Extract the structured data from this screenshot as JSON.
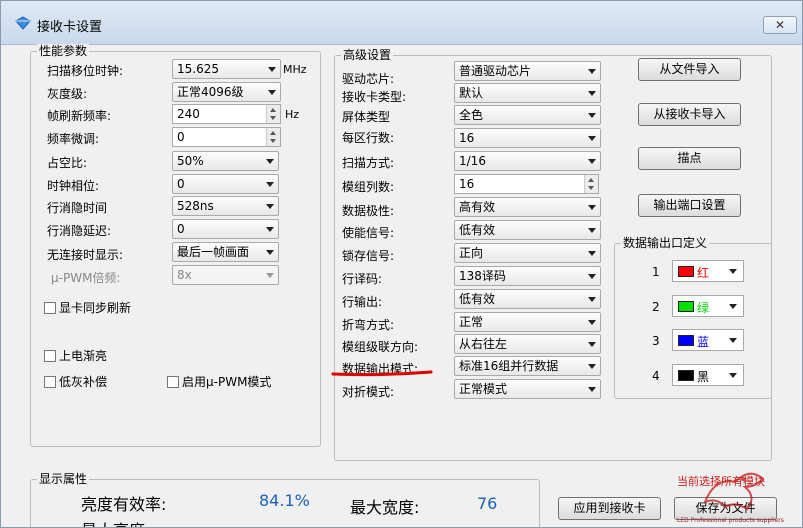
{
  "window": {
    "title": "接收卡设置",
    "close_label": "✕"
  },
  "perf": {
    "legend": "性能参数",
    "scan_clock": {
      "label": "扫描移位时钟:",
      "value": "15.625",
      "unit": "MHz"
    },
    "gray": {
      "label": "灰度级:",
      "value": "正常4096级"
    },
    "refresh": {
      "label": "帧刷新频率:",
      "value": "240",
      "unit": "Hz"
    },
    "freq_fine": {
      "label": "频率微调:",
      "value": "0"
    },
    "duty": {
      "label": "占空比:",
      "value": "50%"
    },
    "clock_phase": {
      "label": "时钟相位:",
      "value": "0"
    },
    "blank_time": {
      "label": "行消隐时间",
      "value": "528ns"
    },
    "blank_delay": {
      "label": "行消隐延迟:",
      "value": "0"
    },
    "no_link": {
      "label": "无连接时显示:",
      "value": "最后一帧画面"
    },
    "upwm_mult": {
      "label": "μ-PWM倍频:",
      "value": "8x"
    },
    "chk_vsync": "显卡同步刷新",
    "chk_poweron": "上电渐亮",
    "chk_lowgray": "低灰补偿",
    "chk_upwm": "启用μ-PWM模式"
  },
  "adv": {
    "legend": "高级设置",
    "driver_chip": {
      "label": "驱动芯片:",
      "value": "普通驱动芯片"
    },
    "card_type": {
      "label": "接收卡类型:",
      "value": "默认"
    },
    "screen_type": {
      "label": "屏体类型",
      "value": "全色"
    },
    "rows_per_zone": {
      "label": "每区行数:",
      "value": "16"
    },
    "scan_mode": {
      "label": "扫描方式:",
      "value": "1/16"
    },
    "module_cols": {
      "label": "模组列数:",
      "value": "16"
    },
    "data_polarity": {
      "label": "数据极性:",
      "value": "高有效"
    },
    "enable_signal": {
      "label": "使能信号:",
      "value": "低有效"
    },
    "latch_signal": {
      "label": "锁存信号:",
      "value": "正向"
    },
    "row_decode": {
      "label": "行译码:",
      "value": "138译码"
    },
    "row_output": {
      "label": "行输出:",
      "value": "低有效"
    },
    "fold_mode": {
      "label": "折弯方式:",
      "value": "正常"
    },
    "cascade_dir": {
      "label": "模组级联方向:",
      "value": "从右往左"
    },
    "data_output_mode": {
      "label": "数据输出模式:",
      "value": "标准16组并行数据"
    },
    "fold_pair_mode": {
      "label": "对折模式:",
      "value": "正常模式"
    }
  },
  "buttons": {
    "import_file": "从文件导入",
    "import_card": "从接收卡导入",
    "trace_point": "描点",
    "output_port": "输出端口设置",
    "apply": "应用到接收卡",
    "save_file": "保存为文件"
  },
  "output_def": {
    "legend": "数据输出口定义",
    "ports": [
      {
        "num": "1",
        "color": "#ff0000",
        "name": "红"
      },
      {
        "num": "2",
        "color": "#00e000",
        "name": "绿"
      },
      {
        "num": "3",
        "color": "#0000ff",
        "name": "蓝"
      },
      {
        "num": "4",
        "color": "#000000",
        "name": "黑"
      }
    ]
  },
  "display": {
    "legend": "显示属性",
    "brightness_label": "亮度有效率:",
    "brightness_value": "84.1%",
    "max_width_label": "最大宽度:",
    "max_width_value": "76",
    "max_height_label": "最大高度:"
  },
  "watermark": {
    "text": "当前选择所有模块",
    "sub": "LED Professional products suppliers"
  },
  "colors": {
    "accent_underline": "#e00000",
    "value_blue": "#1b5fc2"
  }
}
